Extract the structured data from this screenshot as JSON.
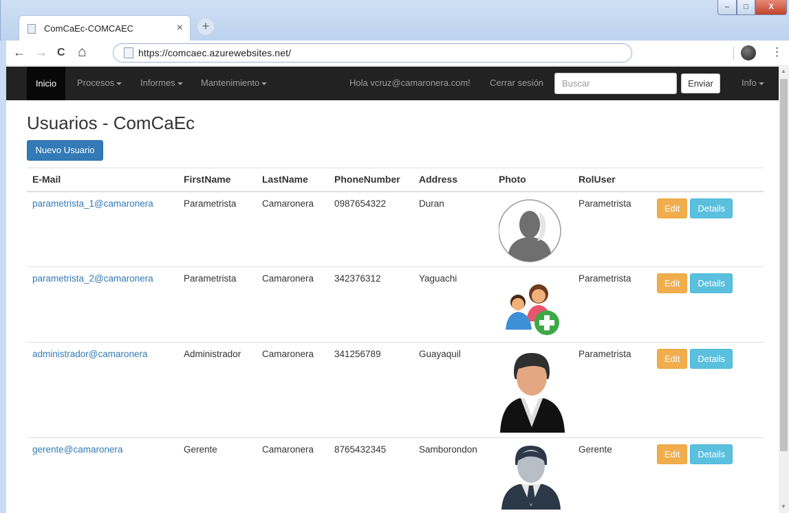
{
  "browser": {
    "tab_title": "ComCaEc-COMCAEC",
    "tab_close": "×",
    "new_tab": "+",
    "url": "https://comcaec.azurewebsites.net/",
    "win_min": "–",
    "win_max": "□",
    "win_close": "X",
    "back": "←",
    "forward": "→",
    "reload": "C",
    "home": "⌂",
    "menu": "⋮"
  },
  "navbar": {
    "home": "Inicio",
    "procesos": "Procesos",
    "informes": "Informes",
    "mantenimiento": "Mantenimiento",
    "greeting": "Hola vcruz@camaronera.com!",
    "logout": "Cerrar sesión",
    "search_placeholder": "Buscar",
    "send": "Enviar",
    "info": "Info"
  },
  "page": {
    "title": "Usuarios - ComCaEc",
    "new_user": "Nuevo Usuario"
  },
  "table": {
    "headers": [
      "E-Mail",
      "FirstName",
      "LastName",
      "PhoneNumber",
      "Address",
      "Photo",
      "RolUser"
    ],
    "edit_label": "Edit",
    "details_label": "Details",
    "rows": [
      {
        "email": "parametrista_1@camaronera",
        "first": "Parametrista",
        "last": "Camaronera",
        "phone": "0987654322",
        "address": "Duran",
        "photo": "gray-person-circle-icon",
        "rol": "Parametrista"
      },
      {
        "email": "parametrista_2@camaronera",
        "first": "Parametrista",
        "last": "Camaronera",
        "phone": "342376312",
        "address": "Yaguachi",
        "photo": "add-users-icon",
        "rol": "Parametrista"
      },
      {
        "email": "administrador@camaronera",
        "first": "Administrador",
        "last": "Camaronera",
        "phone": "341256789",
        "address": "Guayaquil",
        "photo": "business-man-icon",
        "rol": "Parametrista"
      },
      {
        "email": "gerente@camaronera",
        "first": "Gerente",
        "last": "Camaronera",
        "phone": "8765432345",
        "address": "Samborondon",
        "photo": "manager-icon",
        "rol": "Gerente"
      }
    ]
  }
}
